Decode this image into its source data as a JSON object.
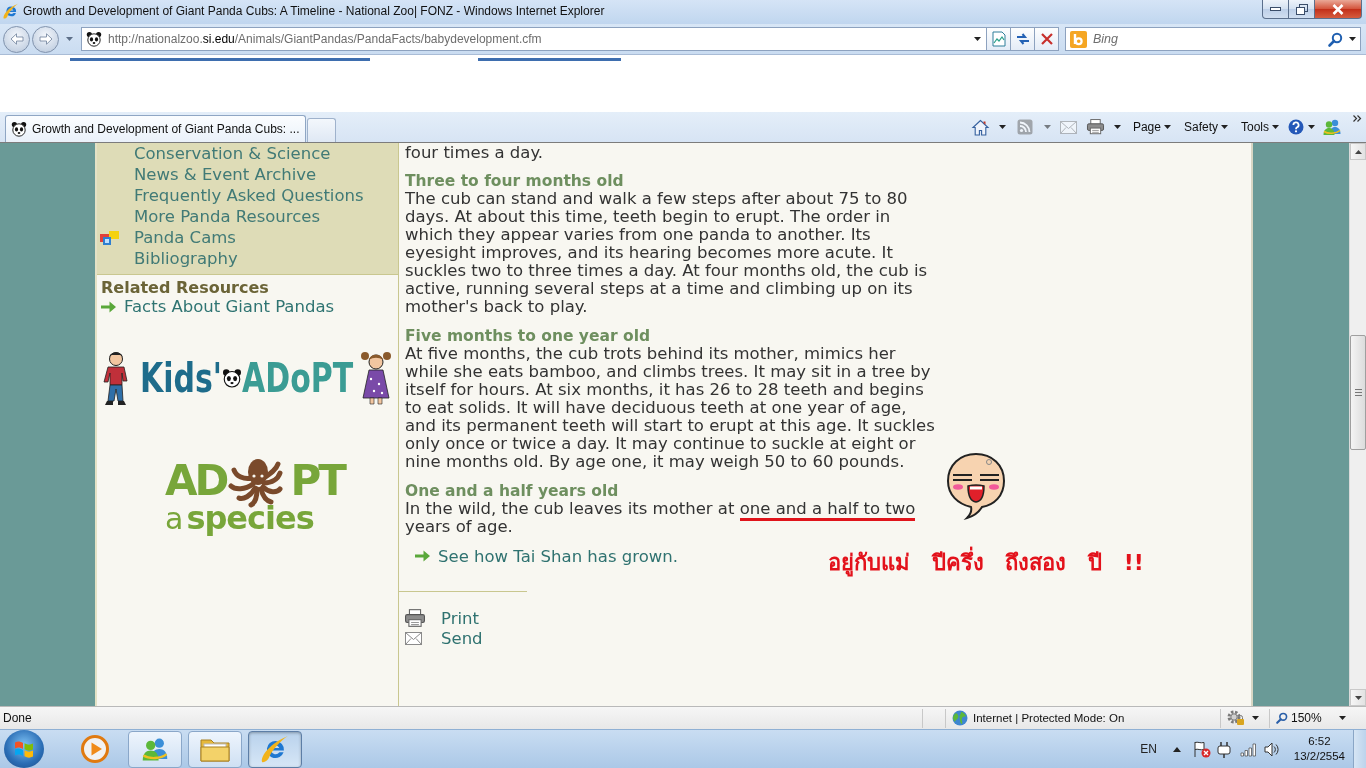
{
  "window": {
    "title": "Growth and Development of Giant Panda Cubs: A Timeline - National Zoo| FONZ - Windows Internet Explorer"
  },
  "address_bar": {
    "url": [
      {
        "text": "http://nationalzoo.",
        "emphasized": false
      },
      {
        "text": "si.edu",
        "emphasized": true
      },
      {
        "text": "/Animals/GiantPandas/PandaFacts/babydevelopment.cfm",
        "emphasized": false
      }
    ]
  },
  "search": {
    "placeholder": "Bing"
  },
  "tabs": [
    {
      "label": "Growth and Development of Giant Panda Cubs: ...",
      "selected": true
    }
  ],
  "command_bar": {
    "buttons": [
      {
        "kind": "home",
        "dropdown": true,
        "disabled": false
      },
      {
        "kind": "feeds",
        "dropdown": true,
        "disabled": true
      },
      {
        "kind": "mail",
        "dropdown": false,
        "disabled": true
      },
      {
        "kind": "print",
        "dropdown": true,
        "disabled": false
      }
    ],
    "menus": [
      "Page",
      "Safety",
      "Tools"
    ]
  },
  "sidebar": {
    "nav_links": [
      {
        "label": "Conservation & Science",
        "icon": false
      },
      {
        "label": "News & Event Archive",
        "icon": false
      },
      {
        "label": "Frequently Asked Questions",
        "icon": false
      },
      {
        "label": "More Panda Resources",
        "icon": false
      },
      {
        "label": "Panda Cams",
        "icon": true
      },
      {
        "label": "Bibliography",
        "icon": false
      }
    ],
    "related_heading": "Related Resources",
    "related_links": [
      "Facts About Giant Pandas"
    ],
    "logos": [
      {
        "kind": "kids_adopt",
        "words": [
          "Kids'",
          "ADoPT"
        ]
      },
      {
        "kind": "adopt_species",
        "words": [
          "AD",
          "PT",
          "a",
          "species"
        ]
      }
    ]
  },
  "content": {
    "lead_in": "four times a day.",
    "sections": [
      {
        "heading": "Three to four months old",
        "parts": [
          {
            "text": "The cub can stand and walk a few steps after about 75 to 80 days. At about this time, teeth begin to erupt. The order in which they appear varies from one panda to another. Its eyesight improves, and its hearing becomes more acute. It suckles two to three times a day. At four months old, the cub is active, running several steps at a time and climbing up on its mother's back to play.",
            "underlined": false
          }
        ]
      },
      {
        "heading": "Five months to one year old",
        "parts": [
          {
            "text": "At five months, the cub trots behind its mother, mimics her while she eats bamboo, and climbs trees. It may sit in a tree by itself for hours. At six months, it has 26 to 28 teeth and begins to eat solids. It will have deciduous teeth at one year of age, and its permanent teeth will start to erupt at this age. It suckles only once or twice a day. It may continue to suckle at eight or nine months old. By age one, it may weigh 50 to 60 pounds.",
            "underlined": false
          }
        ]
      },
      {
        "heading": "One and a half years old",
        "parts": [
          {
            "text": "In the wild, the cub leaves its mother at ",
            "underlined": false
          },
          {
            "text": "one and a half to two",
            "underlined": true
          },
          {
            "text": " years of age.",
            "underlined": false
          }
        ]
      }
    ],
    "more_link": "See how Tai Shan has grown.",
    "actions": [
      {
        "kind": "print",
        "label": "Print"
      },
      {
        "kind": "send",
        "label": "Send"
      }
    ]
  },
  "annotation": {
    "note": "อยู่กับแม่ ปีครึ่ง ถึงสอง ปี !!"
  },
  "status_bar": {
    "text": "Done",
    "zone": "Internet | Protected Mode: On",
    "zoom": "150%"
  },
  "taskbar": {
    "apps": [
      {
        "kind": "media_player",
        "running": false,
        "selected": false
      },
      {
        "kind": "messenger",
        "running": true,
        "selected": false
      },
      {
        "kind": "explorer",
        "running": true,
        "selected": false
      },
      {
        "kind": "browser",
        "running": true,
        "selected": true
      }
    ],
    "language": "EN",
    "time": "6:52",
    "date": "13/2/2554"
  }
}
